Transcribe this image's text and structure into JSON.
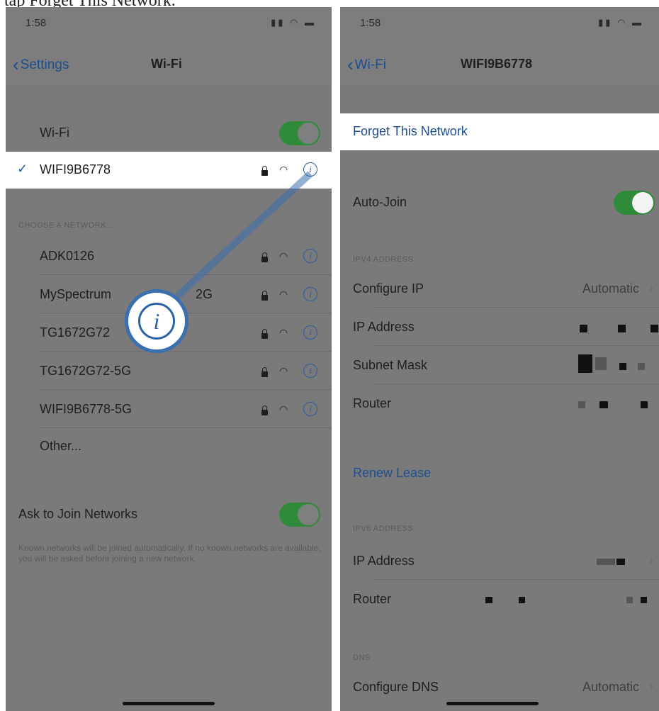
{
  "caption": "tap Forget This Network.",
  "left": {
    "status": {
      "time": "1:58",
      "icons": "signal wifi battery"
    },
    "nav": {
      "back_label": "Settings",
      "title": "Wi-Fi"
    },
    "wifi_row": {
      "label": "Wi-Fi",
      "toggle": "on"
    },
    "connected": {
      "name": "WIFI9B6778"
    },
    "choose_header": "CHOOSE A NETWORK...",
    "networks": [
      {
        "name": "ADK0126"
      },
      {
        "name": "MySpectrum",
        "suffix": "2G"
      },
      {
        "name": "TG1672G72"
      },
      {
        "name": "TG1672G72-5G"
      },
      {
        "name": "WIFI9B6778-5G"
      }
    ],
    "other_label": "Other...",
    "ask_to_join": {
      "label": "Ask to Join Networks",
      "toggle": "on"
    },
    "footnote": "Known networks will be joined automatically. If no known networks are available, you will be asked before joining a new network."
  },
  "right": {
    "status": {
      "time": "1:58",
      "icons": "signal wifi battery"
    },
    "nav": {
      "back_label": "Wi-Fi",
      "title": "WIFI9B6778"
    },
    "forget_label": "Forget This Network",
    "auto_join": {
      "label": "Auto-Join",
      "toggle": "on"
    },
    "ipv4_header": "IPV4 ADDRESS",
    "configure_ip": {
      "label": "Configure IP",
      "value": "Automatic"
    },
    "ip_address_label": "IP Address",
    "subnet_mask_label": "Subnet Mask",
    "router_label": "Router",
    "renew_lease_label": "Renew Lease",
    "ipv6_header": "IPV6 ADDRESS",
    "ipv6_ip_label": "IP Address",
    "ipv6_router_label": "Router",
    "dns_header": "DNS",
    "configure_dns": {
      "label": "Configure DNS",
      "value": "Automatic"
    }
  },
  "colors": {
    "accent": "#2c5c9c",
    "toggle_on": "#2f8a3a"
  }
}
